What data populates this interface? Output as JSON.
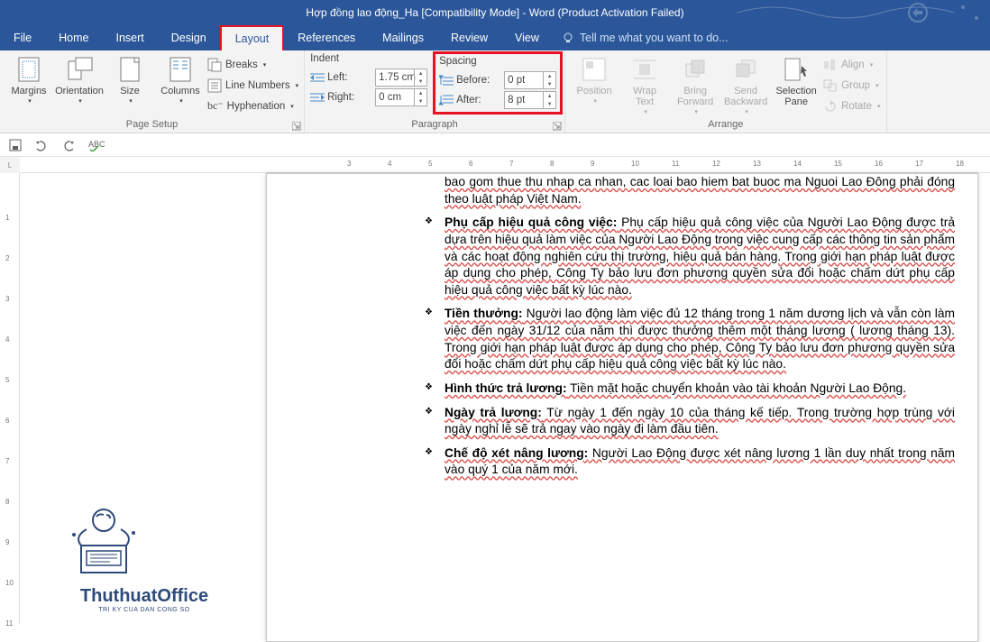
{
  "title": "Hợp đồng lao động_Ha [Compatibility Mode] - Word (Product Activation Failed)",
  "menu": {
    "file": "File",
    "home": "Home",
    "insert": "Insert",
    "design": "Design",
    "layout": "Layout",
    "references": "References",
    "mailings": "Mailings",
    "review": "Review",
    "view": "View",
    "tell": "Tell me what you want to do..."
  },
  "ribbon": {
    "page_setup": {
      "label": "Page Setup",
      "margins": "Margins",
      "orientation": "Orientation",
      "size": "Size",
      "columns": "Columns",
      "breaks": "Breaks",
      "line_numbers": "Line Numbers",
      "hyphenation": "Hyphenation"
    },
    "paragraph": {
      "label": "Paragraph",
      "indent": "Indent",
      "left": "Left:",
      "right": "Right:",
      "left_val": "1.75 cm",
      "right_val": "0 cm",
      "spacing": "Spacing",
      "before": "Before:",
      "after": "After:",
      "before_val": "0 pt",
      "after_val": "8 pt"
    },
    "arrange": {
      "label": "Arrange",
      "position": "Position",
      "wrap": "Wrap\nText",
      "forward": "Bring\nForward",
      "backward": "Send\nBackward",
      "selection": "Selection\nPane",
      "align": "Align",
      "group": "Group",
      "rotate": "Rotate"
    }
  },
  "ruler": {
    "start": 3,
    "end": 18
  },
  "doc": {
    "partial": "bao gom thue thu nhap ca nhan, cac loai bao hiem bat buoc ma Nguoi Lao Đông phải đóng theo luật pháp Việt Nam.",
    "items": [
      {
        "lead": "Phụ cấp hiệu quả công việc:",
        "body": " Phụ cấp hiệu quả công việc của Người Lao Động được trả dựa trên hiệu quả làm việc của Người Lao Động trong việc cung cấp các thông tin sản phẩm và các hoạt động nghiên cứu thị trường, hiệu quả bán hàng. Trong giới hạn pháp luật được áp dụng cho phép, Công Ty bảo lưu đơn phương quyền sửa đổi hoặc chấm dứt phụ cấp hiệu quả công việc bất kỳ lúc nào."
      },
      {
        "lead": "Tiền thưởng:",
        "body": " Người lao động làm việc đủ 12 tháng trong 1 năm dương lịch và vẫn còn làm việc đến ngày 31/12 của năm thì được thưởng thêm một tháng lương ( lương tháng 13). Trong giới hạn pháp luật được áp dụng cho phép, Công Ty bảo lưu đơn phương quyền sửa đổi hoặc chấm dứt phụ cấp hiệu quả công việc bất kỳ lúc nào."
      },
      {
        "lead": "Hình thức trả lương:",
        "body": " Tiền mặt hoặc chuyển khoản vào tài khoản Người Lao Động."
      },
      {
        "lead": "Ngày trả lương:",
        "body": " Từ ngày 1 đến ngày 10 của tháng kế tiếp. Trong trường hợp trùng với ngày nghỉ lễ sẽ trả ngay vào ngày đi làm đầu tiên."
      },
      {
        "lead": "Chế độ xét nâng lương:",
        "body": " Người Lao Động được xét nâng lương 1 lần duy nhất trong năm vào quý 1 của năm mới."
      }
    ]
  },
  "logo": {
    "main": "ThuthuatOffice",
    "sub": "TRI KY CUA DAN CONG SO"
  }
}
